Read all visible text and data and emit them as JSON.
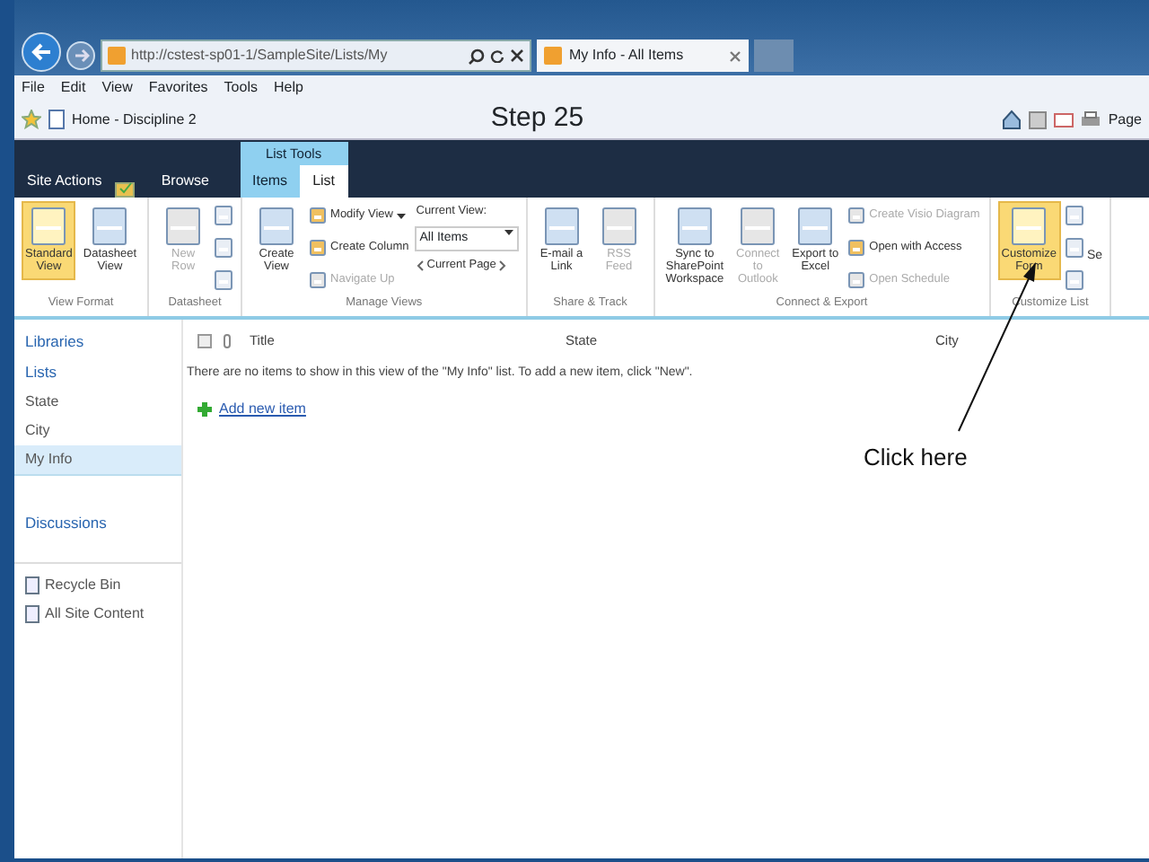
{
  "browser": {
    "address": "http://cstest-sp01-1/SampleSite/Lists/My",
    "tab_title": "My Info - All Items",
    "menu": [
      "File",
      "Edit",
      "View",
      "Favorites",
      "Tools",
      "Help"
    ],
    "favorite": "Home - Discipline 2",
    "toolbar_page": "Page"
  },
  "annotation": {
    "step": "Step 25",
    "callout": "Click here"
  },
  "sharepoint": {
    "site_actions": "Site Actions",
    "context_group": "List Tools",
    "tabs": [
      {
        "label": "Browse",
        "selected": false
      },
      {
        "label": "Items",
        "selected": false
      },
      {
        "label": "List",
        "selected": true
      }
    ]
  },
  "ribbon": [
    {
      "label": "View Format",
      "columns": [
        [
          {
            "kind": "large",
            "label": "Standard View",
            "selected": true,
            "disabled": false
          }
        ],
        [
          {
            "kind": "large",
            "label": "Datasheet View",
            "selected": false,
            "disabled": false
          }
        ]
      ]
    },
    {
      "label": "Datasheet",
      "columns": [
        [
          {
            "kind": "large",
            "label": "New Row",
            "selected": false,
            "disabled": true
          }
        ],
        [
          {
            "kind": "icons"
          }
        ]
      ]
    },
    {
      "label": "Manage Views",
      "columns": [
        [
          {
            "kind": "large",
            "label": "Create View",
            "selected": false,
            "disabled": false
          }
        ],
        [
          {
            "kind": "small",
            "label": "Modify View",
            "caret": true,
            "disabled": false
          },
          {
            "kind": "small",
            "label": "Create Column",
            "disabled": false
          },
          {
            "kind": "small",
            "label": "Navigate Up",
            "disabled": true
          }
        ],
        [
          {
            "kind": "caption",
            "label": "Current View:"
          },
          {
            "kind": "dropdown",
            "label": "All Items"
          },
          {
            "kind": "pager",
            "label": "Current Page"
          }
        ]
      ]
    },
    {
      "label": "Share & Track",
      "columns": [
        [
          {
            "kind": "large",
            "label": "E-mail a Link",
            "selected": false,
            "disabled": false
          }
        ],
        [
          {
            "kind": "large",
            "label": "RSS Feed",
            "selected": false,
            "disabled": true
          }
        ]
      ]
    },
    {
      "label": "Connect & Export",
      "columns": [
        [
          {
            "kind": "large",
            "label": "Sync to SharePoint Workspace",
            "selected": false,
            "disabled": false
          }
        ],
        [
          {
            "kind": "large",
            "label": "Connect to Outlook",
            "selected": false,
            "disabled": true
          }
        ],
        [
          {
            "kind": "large",
            "label": "Export to Excel",
            "selected": false,
            "disabled": false
          }
        ],
        [
          {
            "kind": "small",
            "label": "Create Visio Diagram",
            "disabled": true
          },
          {
            "kind": "small",
            "label": "Open with Access",
            "disabled": false
          },
          {
            "kind": "small",
            "label": "Open Schedule",
            "disabled": true
          }
        ]
      ]
    },
    {
      "label": "Customize List",
      "columns": [
        [
          {
            "kind": "large",
            "label": "Customize Form",
            "selected": true,
            "disabled": false
          }
        ],
        [
          {
            "kind": "icons"
          }
        ],
        [
          {
            "kind": "cut",
            "label": "Se"
          }
        ]
      ]
    }
  ],
  "nav": [
    {
      "kind": "heading",
      "label": "Libraries",
      "selected": false
    },
    {
      "kind": "heading",
      "label": "Lists",
      "selected": false
    },
    {
      "kind": "item",
      "label": "State",
      "selected": false
    },
    {
      "kind": "item",
      "label": "City",
      "selected": false
    },
    {
      "kind": "item",
      "label": "My Info",
      "selected": true
    },
    {
      "kind": "heading",
      "label": "Discussions",
      "selected": false
    },
    {
      "kind": "utility",
      "label": "Recycle Bin",
      "selected": false
    },
    {
      "kind": "utility",
      "label": "All Site Content",
      "selected": false
    }
  ],
  "list": {
    "select_all_checked": false,
    "columns": [
      "Title",
      "State",
      "City"
    ],
    "empty_message": "There are no items to show in this view of the \"My Info\" list. To add a new item, click \"New\".",
    "add_link": "Add new item"
  }
}
